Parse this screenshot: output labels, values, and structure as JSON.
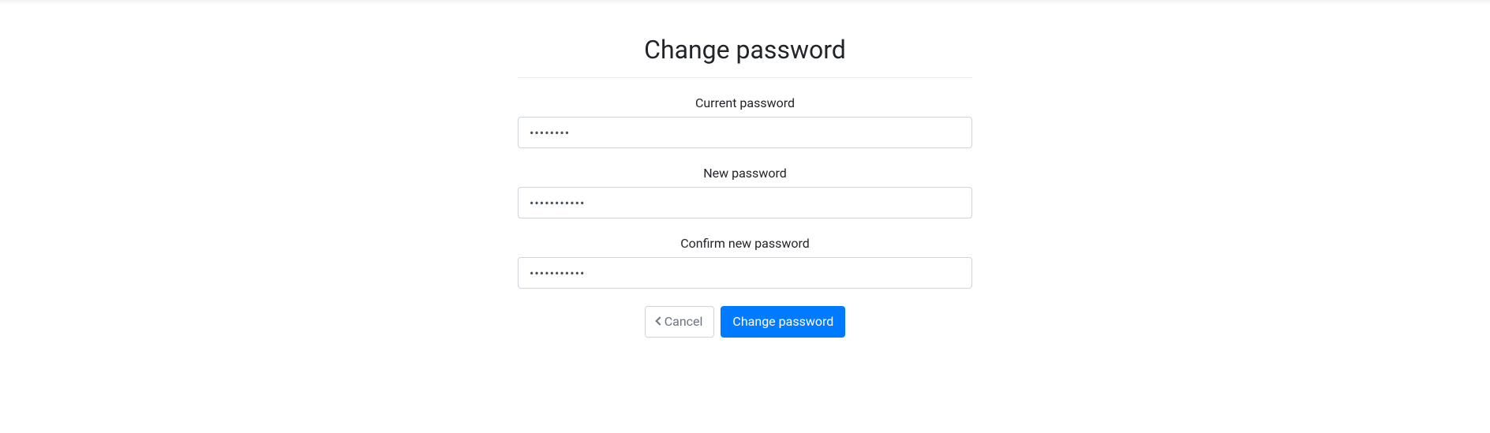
{
  "title": "Change password",
  "fields": {
    "current": {
      "label": "Current password",
      "value": "••••••••"
    },
    "new": {
      "label": "New password",
      "value": "•••••••••••"
    },
    "confirm": {
      "label": "Confirm new password",
      "value": "•••••••••••"
    }
  },
  "buttons": {
    "cancel": "Cancel",
    "submit": "Change password"
  }
}
